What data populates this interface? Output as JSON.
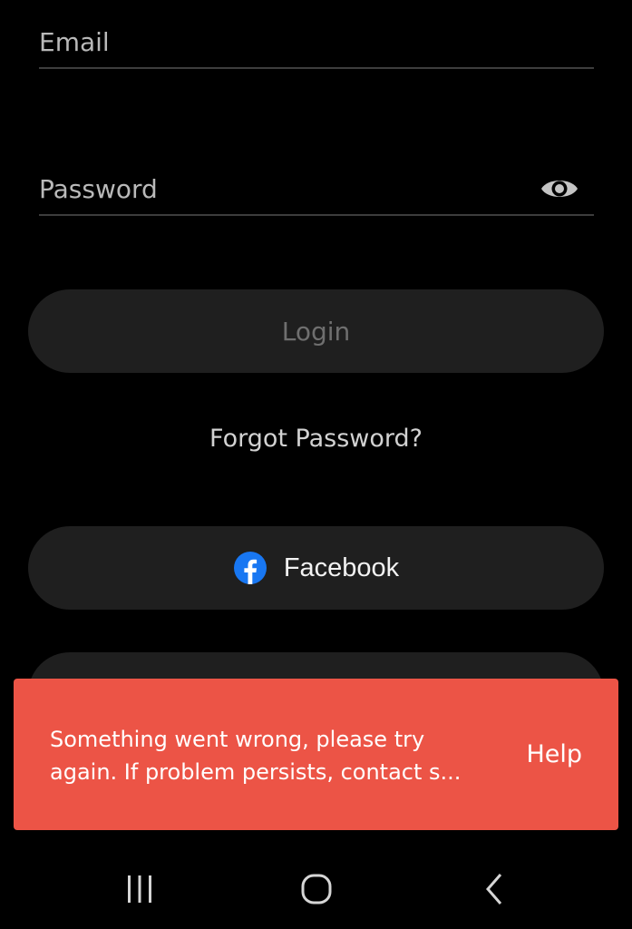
{
  "form": {
    "email_placeholder": "Email",
    "password_placeholder": "Password",
    "login_label": "Login",
    "forgot_password_label": "Forgot Password?",
    "facebook_label": "Facebook"
  },
  "snackbar": {
    "message_line_1": "Something went wrong, please try",
    "message_line_2": "again. If problem persists, contact s...",
    "action_label": "Help"
  },
  "icons": {
    "password_visibility": "eye-icon",
    "facebook": "facebook-logo-icon",
    "nav_recents": "recents-icon",
    "nav_home": "home-icon",
    "nav_back": "back-icon"
  },
  "colors": {
    "background": "#000000",
    "button_fill": "#1f1f1f",
    "snackbar": "#ec5446",
    "facebook_blue": "#1877f2"
  }
}
